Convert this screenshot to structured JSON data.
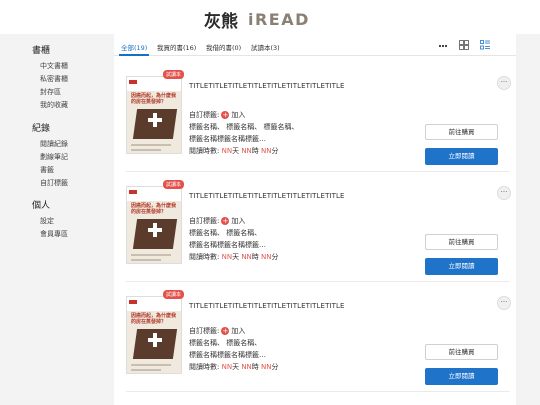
{
  "header": {
    "logo_cn": "灰熊",
    "logo_en": "iREAD"
  },
  "sidebar": {
    "sections": [
      {
        "title": "書櫃",
        "items": [
          "中文書櫃",
          "私密書櫃",
          "封存區",
          "我的收藏"
        ]
      },
      {
        "title": "紀錄",
        "items": [
          "閱讀紀錄",
          "劃線筆記",
          "書籤",
          "自訂標籤"
        ]
      },
      {
        "title": "個人",
        "items": [
          "設定",
          "會員專區"
        ]
      }
    ]
  },
  "tabs": [
    {
      "label": "全部(19)",
      "active": true
    },
    {
      "label": "我買的書(16)",
      "active": false
    },
    {
      "label": "我借的書(0)",
      "active": false
    },
    {
      "label": "試讀本(3)",
      "active": false
    }
  ],
  "toolbar": {
    "more_icon": "more-horizontal-icon",
    "grid_icon": "grid-view-icon",
    "list_icon": "list-view-icon"
  },
  "books": [
    {
      "badge": "試讀本",
      "cover_title": "因癌而起，為什麼我的房在蒸發掉？",
      "title": "TITLETITLETITLETITLETITLETITLETITLETITLE",
      "tag_label": "自訂標籤:",
      "tag_add": "加入",
      "tags_line1": "標籤名稱、 標籤名稱、 標籤名稱、",
      "tags_line2": "標籤名稱標籤名稱標籤…",
      "time_prefix": "閱讀時數:",
      "days": "NN",
      "days_unit": "天",
      "hours": "NN",
      "hours_unit": "時",
      "minutes": "NN",
      "minutes_unit": "分",
      "buy_label": "前往購買",
      "read_label": "立即閱讀"
    },
    {
      "badge": "試讀本",
      "cover_title": "因癌而起，為什麼我的房在蒸發掉？",
      "title": "TITLETITLETITLETITLETITLETITLETITLETITLE",
      "tag_label": "自訂標籤:",
      "tag_add": "加入",
      "tags_line1": "標籤名稱、 標籤名稱、",
      "tags_line2": "標籤名稱標籤名稱標籤…",
      "time_prefix": "閱讀時數:",
      "days": "NN",
      "days_unit": "天",
      "hours": "NN",
      "hours_unit": "時",
      "minutes": "NN",
      "minutes_unit": "分",
      "buy_label": "前往購買",
      "read_label": "立即閱讀"
    },
    {
      "badge": "試讀本",
      "cover_title": "因癌而起，為什麼我的房在蒸發掉？",
      "title": "TITLETITLETITLETITLETITLETITLETITLETITLE",
      "tag_label": "自訂標籤:",
      "tag_add": "加入",
      "tags_line1": "標籤名稱、 標籤名稱、",
      "tags_line2": "標籤名稱標籤名稱標籤…",
      "time_prefix": "閱讀時數:",
      "days": "NN",
      "days_unit": "天",
      "hours": "NN",
      "hours_unit": "時",
      "minutes": "NN",
      "minutes_unit": "分",
      "buy_label": "前往購買",
      "read_label": "立即閱讀"
    }
  ],
  "colors": {
    "accent_blue": "#1f74c9",
    "accent_red": "#e4504a",
    "logo_brown": "#8a8073"
  }
}
